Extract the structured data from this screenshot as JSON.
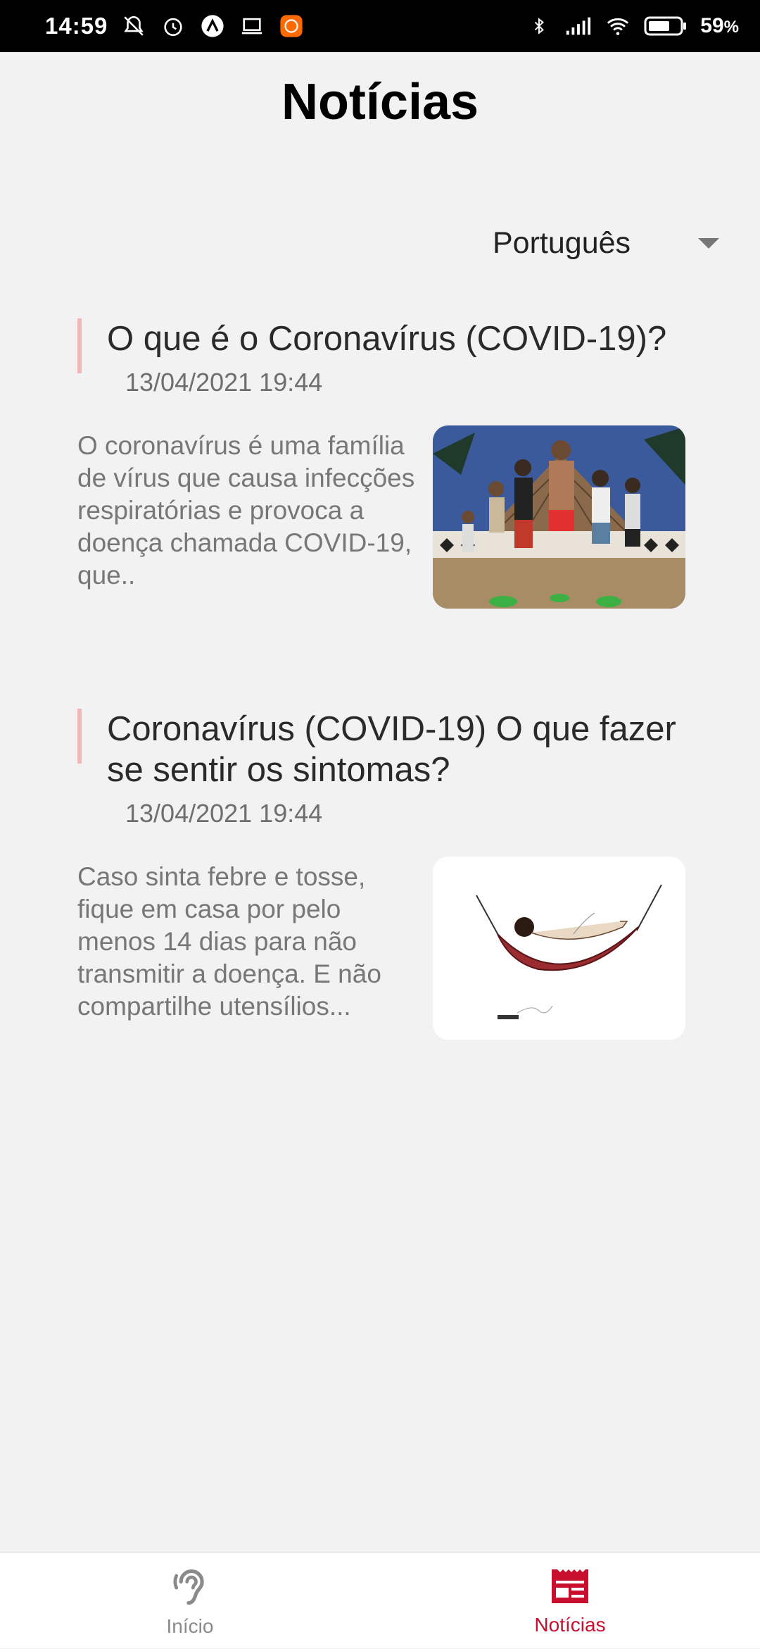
{
  "status_bar": {
    "time": "14:59",
    "battery_percent": "59",
    "battery_suffix": "%",
    "left_icons": [
      "bell-off-icon",
      "alarm-icon",
      "app-a-icon",
      "laptop-icon",
      "mi-app-icon"
    ],
    "right_icons": [
      "bluetooth-icon",
      "signal-icon",
      "wifi-icon",
      "battery-icon"
    ]
  },
  "header": {
    "title": "Notícias"
  },
  "language": {
    "selected": "Português"
  },
  "news": [
    {
      "title": "O que é o Coronavírus (COVID-19)?",
      "date": "13/04/2021 19:44",
      "excerpt": "O coronavírus é uma família de vírus que causa infecções respiratórias e provoca a doença chamada COVID-19, que.."
    },
    {
      "title": "Coronavírus (COVID-19) O que fazer se sentir os sintomas?",
      "date": "13/04/2021 19:44",
      "excerpt": "Caso sinta febre e tosse, fique em casa por pelo menos 14 dias para não transmitir a doença. E não compartilhe utensílios..."
    }
  ],
  "bottom_nav": {
    "items": [
      {
        "label": "Início",
        "icon": "ear-icon",
        "active": false
      },
      {
        "label": "Notícias",
        "icon": "newspaper-icon",
        "active": true
      }
    ]
  },
  "colors": {
    "accent": "#c8102e",
    "title_bar_accent": "#f4b7b7",
    "background": "#f2f2f2"
  }
}
